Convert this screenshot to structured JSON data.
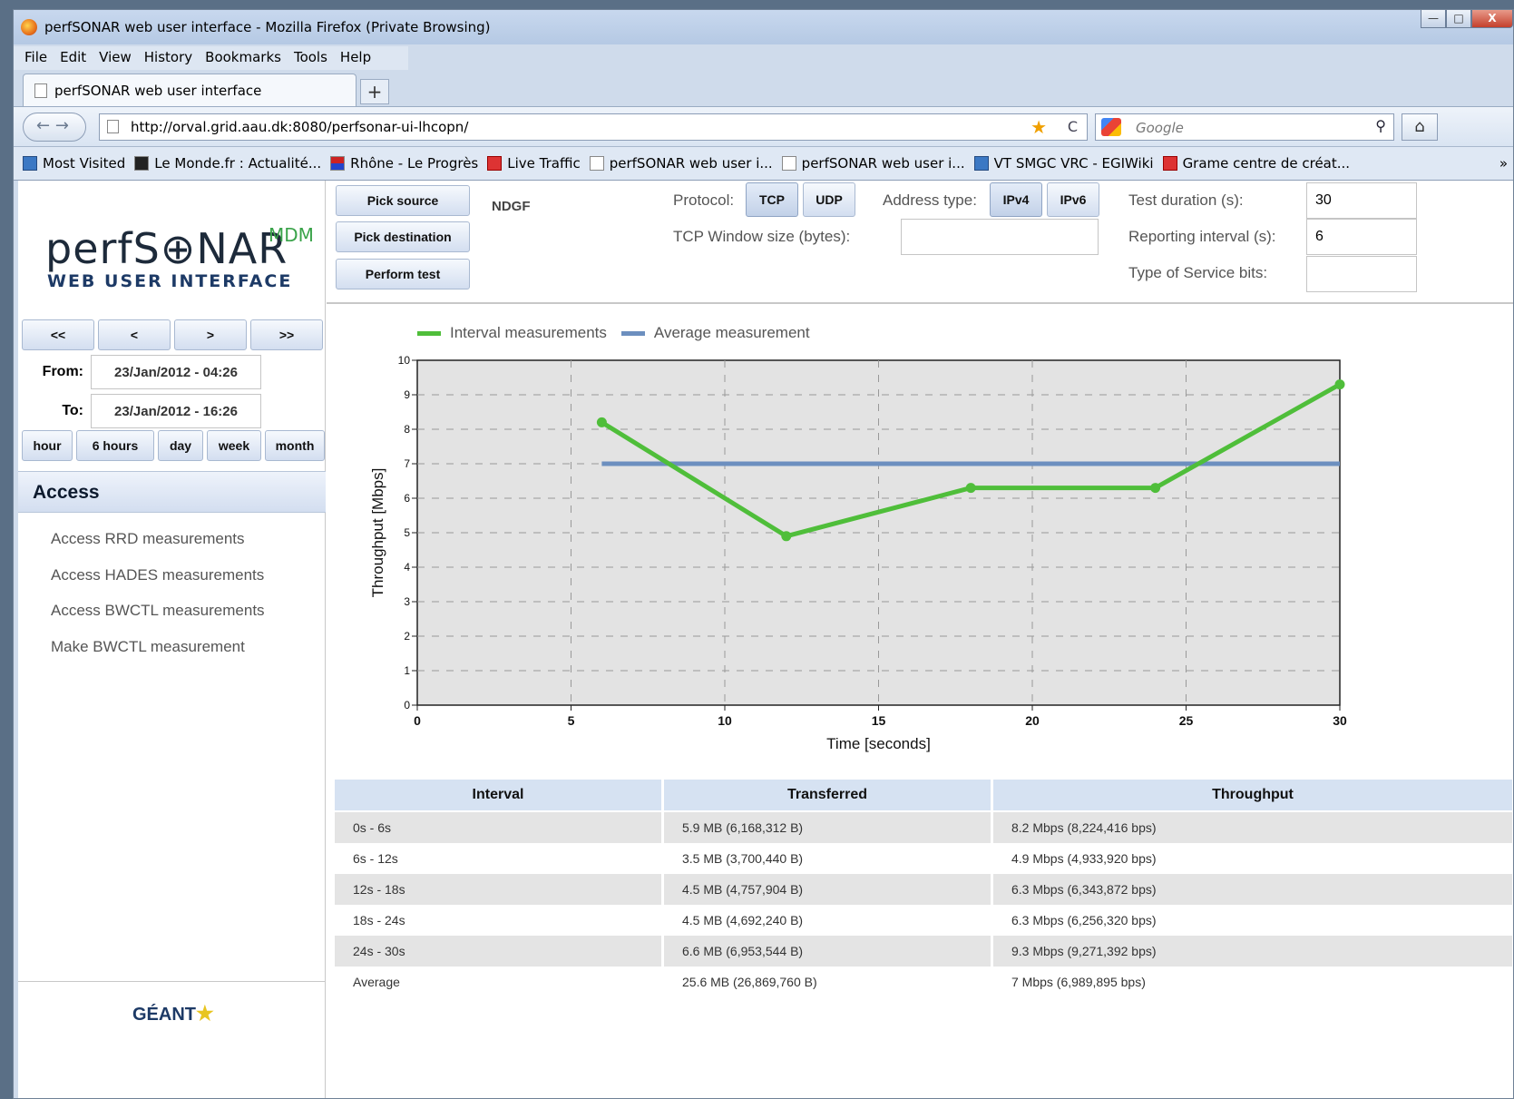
{
  "window": {
    "title": "perfSONAR web user interface - Mozilla Firefox (Private Browsing)",
    "controls": {
      "minimize": "—",
      "maximize": "□",
      "close": "X"
    }
  },
  "menu": [
    "File",
    "Edit",
    "View",
    "History",
    "Bookmarks",
    "Tools",
    "Help"
  ],
  "tab": {
    "label": "perfSONAR web user interface",
    "new_tab": "+"
  },
  "nav": {
    "back": "←",
    "forward": "→",
    "url": "http://orval.grid.aau.dk:8080/perfsonar-ui-lhcopn/",
    "search_placeholder": "Google",
    "home": "⌂",
    "reload": "C"
  },
  "bookmarks": [
    {
      "label": "Most Visited",
      "icon": "most-visited-icon"
    },
    {
      "label": "Le Monde.fr : Actualité...",
      "icon": "le-monde-icon"
    },
    {
      "label": "Rhône - Le Progrès",
      "icon": "le-progres-icon"
    },
    {
      "label": "Live Traffic",
      "icon": "live-traffic-icon"
    },
    {
      "label": "perfSONAR web user i...",
      "icon": "page-icon"
    },
    {
      "label": "perfSONAR web user i...",
      "icon": "page-icon"
    },
    {
      "label": "VT SMGC VRC - EGIWiki",
      "icon": "egi-icon"
    },
    {
      "label": "Grame centre de créat...",
      "icon": "grame-icon"
    }
  ],
  "bookmarks_overflow": "»",
  "sidebar": {
    "logo_main": "perfS⊕NAR",
    "logo_super": "MDM",
    "logo_sub": "WEB USER INTERFACE",
    "nav_buttons": [
      "<<",
      "<",
      ">",
      ">>"
    ],
    "from_label": "From:",
    "from_value": "23/Jan/2012 - 04:26",
    "to_label": "To:",
    "to_value": "23/Jan/2012 - 16:26",
    "periods": [
      "hour",
      "6 hours",
      "day",
      "week",
      "month"
    ],
    "access_heading": "Access",
    "access_links": [
      "Access RRD measurements",
      "Access HADES measurements",
      "Access BWCTL measurements",
      "Make BWCTL measurement"
    ],
    "footer_logo": "GÉANT"
  },
  "toolbar": {
    "pick_source": "Pick source",
    "pick_destination": "Pick destination",
    "perform_test": "Perform test",
    "source_value": "NDGF",
    "protocol_label": "Protocol:",
    "tcp": "TCP",
    "udp": "UDP",
    "address_label": "Address type:",
    "ipv4": "IPv4",
    "ipv6": "IPv6",
    "window_label": "TCP Window size (bytes):",
    "window_value": "",
    "duration_label": "Test duration (s):",
    "duration_value": "30",
    "interval_label": "Reporting interval (s):",
    "interval_value": "6",
    "tos_label": "Type of Service bits:",
    "tos_value": ""
  },
  "chart_data": {
    "type": "line",
    "xlabel": "Time [seconds]",
    "ylabel": "Throughput [Mbps]",
    "xlim": [
      0,
      30
    ],
    "ylim": [
      0,
      10
    ],
    "xticks": [
      0,
      5,
      10,
      15,
      20,
      25,
      30
    ],
    "yticks": [
      0,
      1,
      2,
      3,
      4,
      5,
      6,
      7,
      8,
      9,
      10
    ],
    "grid": true,
    "legend": "top-left",
    "series": [
      {
        "name": "Interval measurements",
        "color": "#4fbe3a",
        "x": [
          6,
          12,
          18,
          24,
          30
        ],
        "y": [
          8.2,
          4.9,
          6.3,
          6.3,
          9.3
        ]
      },
      {
        "name": "Average measurement",
        "color": "#6c8fbf",
        "x": [
          6,
          30
        ],
        "y": [
          7.0,
          7.0
        ]
      }
    ]
  },
  "table": {
    "headers": [
      "Interval",
      "Transferred",
      "Throughput"
    ],
    "rows": [
      [
        "0s - 6s",
        "5.9 MB (6,168,312 B)",
        "8.2 Mbps (8,224,416 bps)"
      ],
      [
        "6s - 12s",
        "3.5 MB (3,700,440 B)",
        "4.9 Mbps (4,933,920 bps)"
      ],
      [
        "12s - 18s",
        "4.5 MB (4,757,904 B)",
        "6.3 Mbps (6,343,872 bps)"
      ],
      [
        "18s - 24s",
        "4.5 MB (4,692,240 B)",
        "6.3 Mbps (6,256,320 bps)"
      ],
      [
        "24s - 30s",
        "6.6 MB (6,953,544 B)",
        "9.3 Mbps (9,271,392 bps)"
      ],
      [
        "Average",
        "25.6 MB (26,869,760 B)",
        "7 Mbps (6,989,895 bps)"
      ]
    ]
  }
}
